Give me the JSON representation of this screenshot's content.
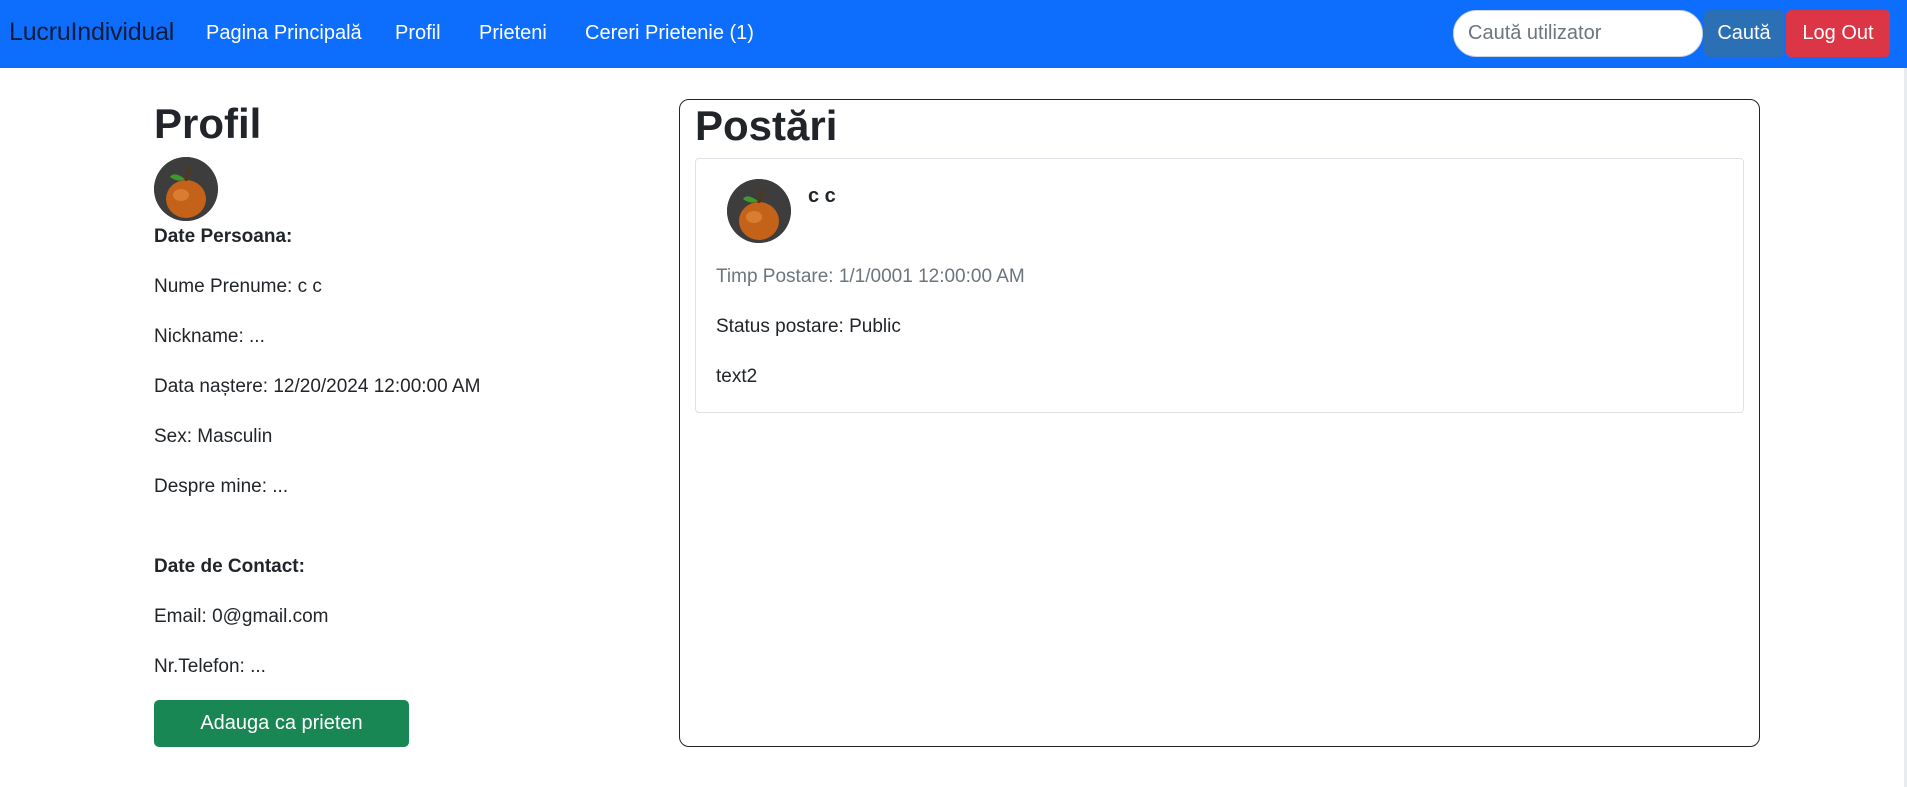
{
  "navbar": {
    "brand": "LucruIndividual",
    "links": [
      "Pagina Principală",
      "Profil",
      "Prieteni",
      "Cereri Prietenie (1)"
    ],
    "search_placeholder": "Caută utilizator",
    "search_label": "Caută",
    "logout_label": "Log Out",
    "color": "#0d6efd"
  },
  "profile": {
    "title": "Profil",
    "avatar_icon": "pear-icon",
    "personal_heading": "Date Persoana:",
    "personal": [
      "Nume Prenume: c c",
      "Nickname: ...",
      "Data naștere: 12/20/2024 12:00:00 AM",
      "Sex: Masculin",
      "Despre mine: ..."
    ],
    "contact_heading": "Date de Contact:",
    "contact": [
      "Email: 0@gmail.com",
      "Nr.Telefon: ..."
    ],
    "add_friend_label": "Adauga ca prieten",
    "add_friend_color": "#198754"
  },
  "posts": {
    "title": "Postări",
    "items": [
      {
        "author": "c c",
        "time": "Timp Postare: 1/1/0001 12:00:00 AM",
        "status": "Status postare: Public",
        "text": "text2"
      }
    ]
  },
  "colors": {
    "danger": "#dc3545",
    "muted": "#6c757d"
  }
}
